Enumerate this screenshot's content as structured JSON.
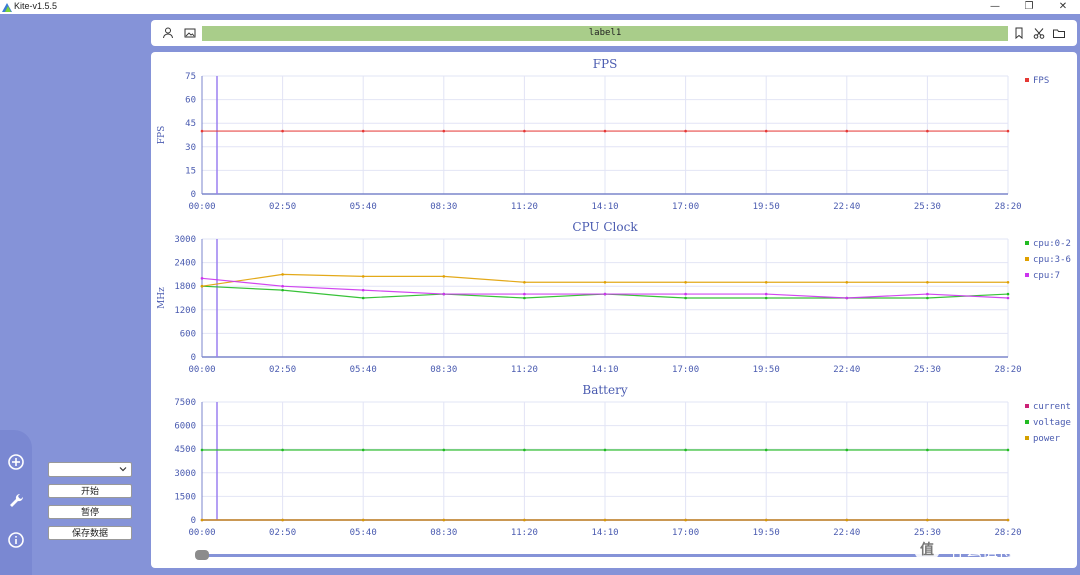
{
  "app": {
    "title": "Kite-v1.5.5"
  },
  "window": {
    "minimize": "—",
    "restore": "❐",
    "close": "✕"
  },
  "toolbar": {
    "label": "label1"
  },
  "sidebar": {
    "select_value": "",
    "start_label": "开始",
    "pause_label": "暂停",
    "save_label": "保存数据"
  },
  "watermark": {
    "text": "什么值得买"
  },
  "colors": {
    "accent": "#8593d8",
    "label_bar": "#a9cd8a",
    "fps": "#e53935",
    "cpu02": "#22bb22",
    "cpu36": "#e0a000",
    "cpu7": "#cc33ee",
    "current": "#cc2277",
    "voltage": "#22bb22",
    "power": "#d4a000"
  },
  "chart_data": [
    {
      "type": "line",
      "title": "FPS",
      "ylabel": "FPS",
      "xlabel": "",
      "ylim": [
        0,
        75
      ],
      "yticks": [
        "0",
        "15",
        "30",
        "45",
        "60",
        "75"
      ],
      "xticks": [
        "00:00",
        "02:50",
        "05:40",
        "08:30",
        "11:20",
        "14:10",
        "17:00",
        "19:50",
        "22:40",
        "25:30",
        "28:20"
      ],
      "series": [
        {
          "name": "FPS",
          "color": "#e53935",
          "values": [
            40,
            40,
            40,
            40,
            40,
            40,
            40,
            40,
            40,
            40,
            40
          ]
        }
      ],
      "grid": true,
      "legend": "right"
    },
    {
      "type": "line",
      "title": "CPU Clock",
      "ylabel": "MHz",
      "xlabel": "",
      "ylim": [
        0,
        3000
      ],
      "yticks": [
        "0",
        "600",
        "1200",
        "1800",
        "2400",
        "3000"
      ],
      "xticks": [
        "00:00",
        "02:50",
        "05:40",
        "08:30",
        "11:20",
        "14:10",
        "17:00",
        "19:50",
        "22:40",
        "25:30",
        "28:20"
      ],
      "series": [
        {
          "name": "cpu:0-2",
          "color": "#22bb22",
          "values": [
            1800,
            1700,
            1500,
            1600,
            1500,
            1600,
            1500,
            1500,
            1500,
            1500,
            1600
          ]
        },
        {
          "name": "cpu:3-6",
          "color": "#e0a000",
          "values": [
            1800,
            2100,
            2050,
            2050,
            1900,
            1900,
            1900,
            1900,
            1900,
            1900,
            1900
          ]
        },
        {
          "name": "cpu:7",
          "color": "#cc33ee",
          "values": [
            2000,
            1800,
            1700,
            1600,
            1600,
            1600,
            1600,
            1600,
            1500,
            1600,
            1500
          ]
        }
      ],
      "grid": true,
      "legend": "right"
    },
    {
      "type": "line",
      "title": "Battery",
      "ylabel": "",
      "xlabel": "",
      "ylim": [
        0,
        7500
      ],
      "yticks": [
        "0",
        "1500",
        "3000",
        "4500",
        "6000",
        "7500"
      ],
      "xticks": [
        "00:00",
        "02:50",
        "05:40",
        "08:30",
        "11:20",
        "14:10",
        "17:00",
        "19:50",
        "22:40",
        "25:30",
        "28:20"
      ],
      "series": [
        {
          "name": "current",
          "color": "#cc2277",
          "values": [
            0,
            0,
            0,
            0,
            0,
            0,
            0,
            0,
            0,
            0,
            0
          ]
        },
        {
          "name": "voltage",
          "color": "#22bb22",
          "values": [
            4450,
            4450,
            4450,
            4450,
            4450,
            4450,
            4450,
            4450,
            4450,
            4450,
            4450
          ]
        },
        {
          "name": "power",
          "color": "#d4a000",
          "values": [
            0,
            0,
            0,
            0,
            0,
            0,
            0,
            0,
            0,
            0,
            0
          ]
        }
      ],
      "grid": true,
      "legend": "right"
    }
  ]
}
